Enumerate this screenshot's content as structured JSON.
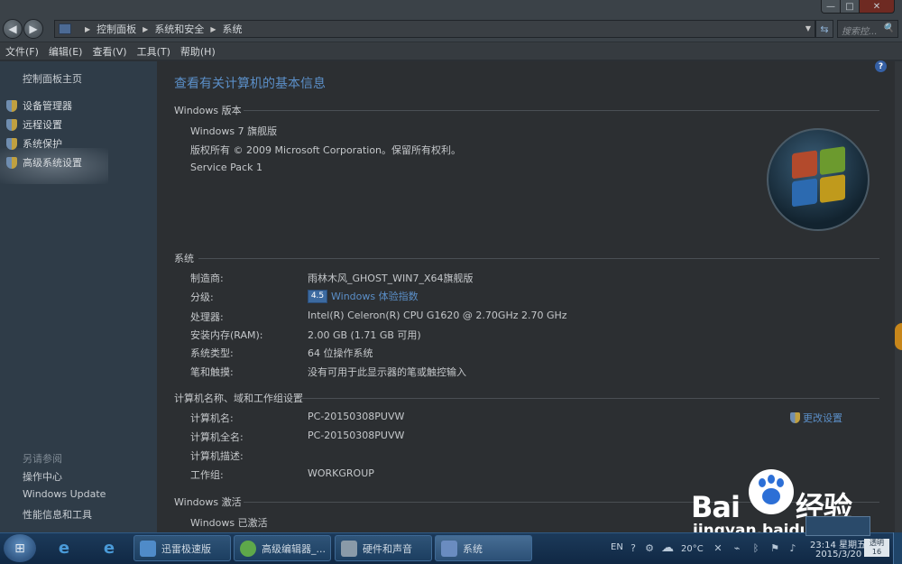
{
  "window": {
    "title": "",
    "controls": {
      "minimize": "—",
      "maximize": "□",
      "close": "✕"
    }
  },
  "address_bar": {
    "breadcrumbs": [
      "控制面板",
      "系统和安全",
      "系统"
    ],
    "search_placeholder": "搜索控...",
    "search_icon": "🔍"
  },
  "menu": [
    "文件(F)",
    "编辑(E)",
    "查看(V)",
    "工具(T)",
    "帮助(H)"
  ],
  "sidebar": {
    "home": "控制面板主页",
    "tasks": [
      "设备管理器",
      "远程设置",
      "系统保护",
      "高级系统设置"
    ],
    "see_also_title": "另请参阅",
    "see_also": [
      "操作中心",
      "Windows Update",
      "性能信息和工具"
    ]
  },
  "main": {
    "title": "查看有关计算机的基本信息",
    "edition": {
      "heading": "Windows 版本",
      "name": "Windows 7 旗舰版",
      "copyright": "版权所有 © 2009 Microsoft Corporation。保留所有权利。",
      "service_pack": "Service Pack 1"
    },
    "system": {
      "heading": "系统",
      "rows": [
        {
          "label": "制造商:",
          "value": "雨林木风_GHOST_WIN7_X64旗舰版"
        },
        {
          "label": "分级:",
          "value": "Windows 体验指数"
        },
        {
          "label": "处理器:",
          "value": "Intel(R) Celeron(R) CPU G1620 @ 2.70GHz   2.70 GHz"
        },
        {
          "label": "安装内存(RAM):",
          "value": "2.00 GB (1.71 GB 可用)"
        },
        {
          "label": "系统类型:",
          "value": "64 位操作系统"
        },
        {
          "label": "笔和触摸:",
          "value": "没有可用于此显示器的笔或触控输入"
        }
      ],
      "rating_score": "4.5"
    },
    "computer": {
      "heading": "计算机名称、域和工作组设置",
      "change_settings": "更改设置",
      "rows": [
        {
          "label": "计算机名:",
          "value": "PC-20150308PUVW"
        },
        {
          "label": "计算机全名:",
          "value": "PC-20150308PUVW"
        },
        {
          "label": "计算机描述:",
          "value": ""
        },
        {
          "label": "工作组:",
          "value": "WORKGROUP"
        }
      ]
    },
    "activation": {
      "heading": "Windows 激活",
      "status": "Windows 已激活"
    },
    "help": "?"
  },
  "taskbar": {
    "buttons": [
      "迅雷极速版",
      "高级编辑器_...",
      "硬件和声音",
      "系统"
    ],
    "tray": {
      "lang": "EN",
      "temperature": "20°C",
      "time": "23:14 星期五",
      "date": "2015/3/20",
      "badge": "透明 16"
    }
  },
  "watermark": {
    "brand": "Bai",
    "brand_suffix": "经验",
    "url": "jingyan.baidu.com"
  },
  "colors": {
    "link": "#5b8fc8",
    "sidebar": "#2f3c48",
    "taskbar": "#1c3a5a"
  }
}
